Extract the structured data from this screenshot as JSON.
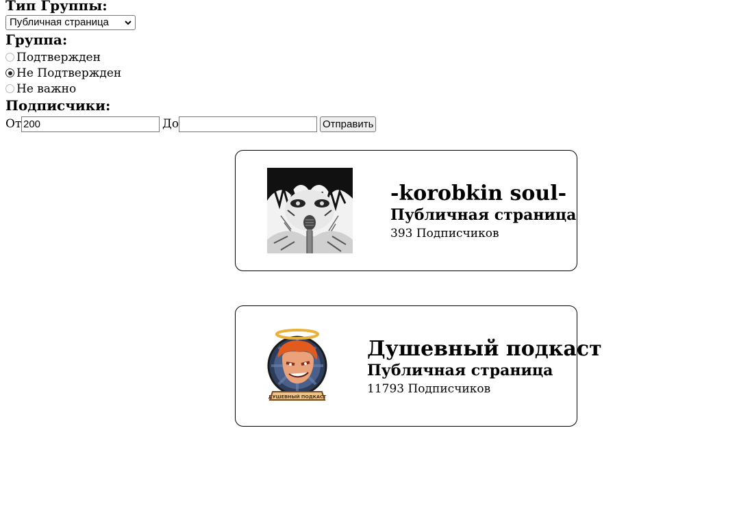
{
  "filters": {
    "group_type_label": "Тип Группы:",
    "group_type_selected": "Публичная страница",
    "group_label": "Группа:",
    "group_options": [
      "Подтвержден",
      "Не Подтвержден",
      "Не важно"
    ],
    "group_selected_index": 1,
    "subscribers_label": "Подписчики:",
    "from_label": "От",
    "from_value": "200",
    "to_label": "До",
    "to_value": "",
    "submit_label": "Отправить"
  },
  "results": [
    {
      "name": "-korobkin soul-",
      "type": "Публичная страница",
      "subscribers": "393 Подписчиков",
      "avatar": "manga-portrait-avatar"
    },
    {
      "name": "Душевный подкаст",
      "type": "Публичная страница",
      "subscribers": "11793 Подписчиков",
      "avatar": "podcast-logo-avatar",
      "avatar_caption": "ДУШЕВНЫЙ ПОДКАСТ"
    }
  ]
}
